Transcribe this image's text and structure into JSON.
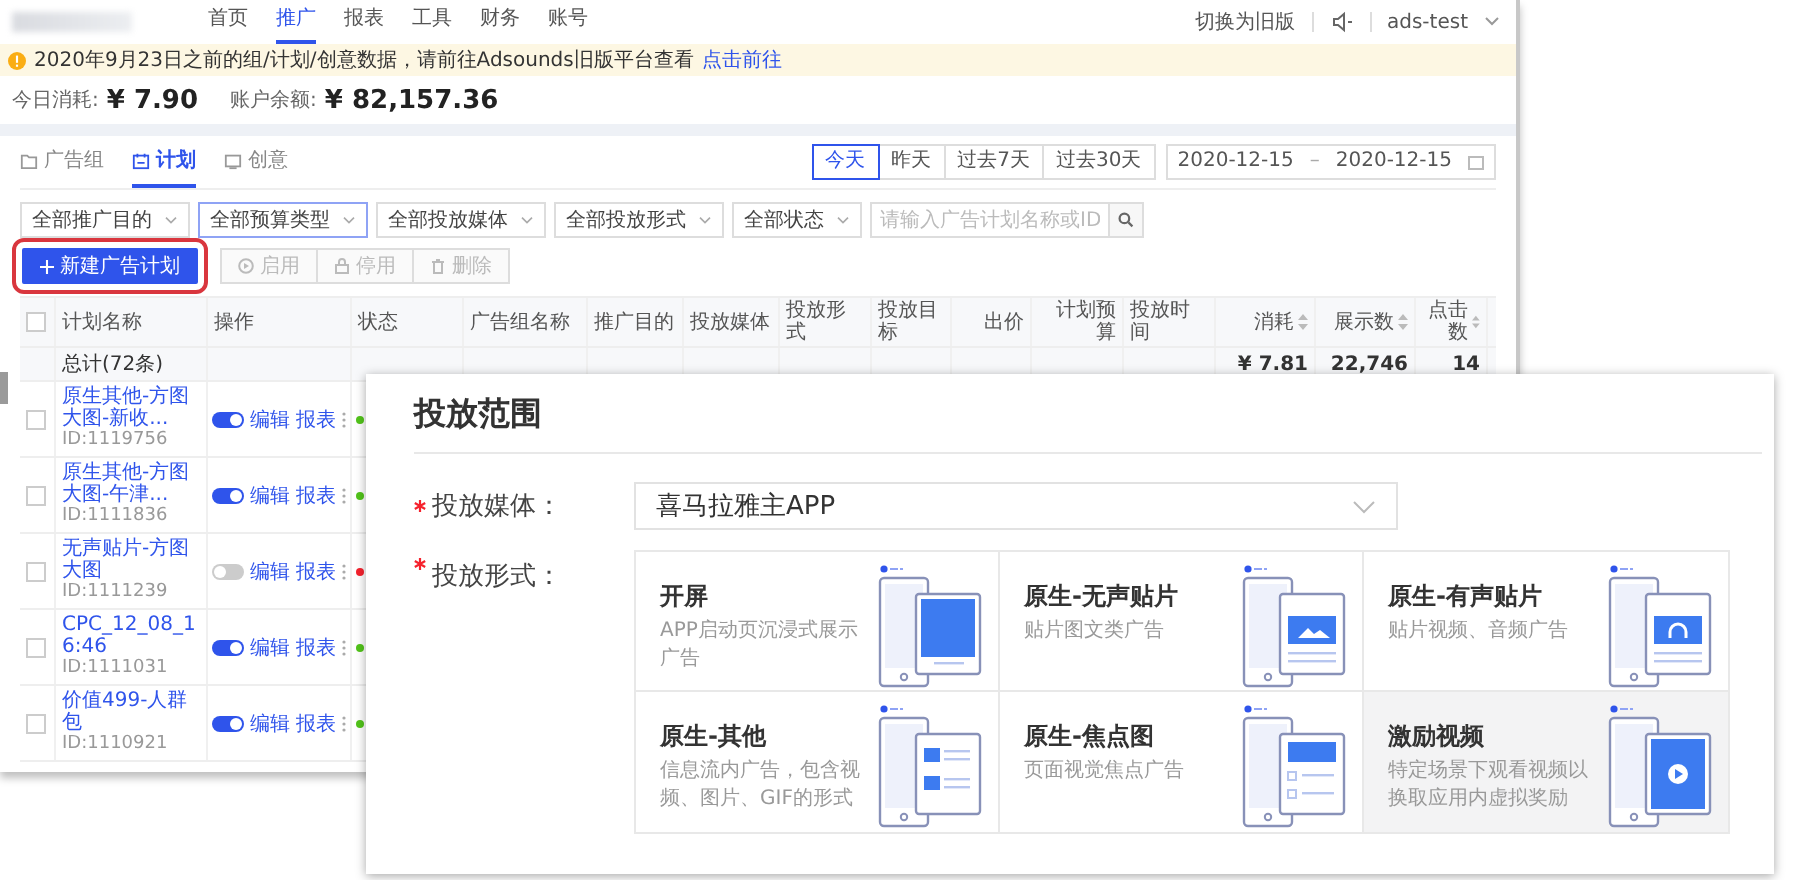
{
  "nav": {
    "items": [
      {
        "label": "首页",
        "selected": false
      },
      {
        "label": "推广",
        "selected": true
      },
      {
        "label": "报表",
        "selected": false
      },
      {
        "label": "工具",
        "selected": false
      },
      {
        "label": "财务",
        "selected": false
      },
      {
        "label": "账号",
        "selected": false
      }
    ],
    "switch_link": "切换为旧版",
    "user": "ads-test"
  },
  "notice": {
    "text": "2020年9月23日之前的组/计划/创意数据，请前往Adsounds旧版平台查看",
    "link": "点击前往"
  },
  "stats": [
    {
      "label": "今日消耗:",
      "value": "¥ 7.90"
    },
    {
      "label": "账户余额:",
      "value": "¥ 82,157.36"
    }
  ],
  "level_tabs": [
    {
      "label": "广告组",
      "kind": "group",
      "selected": false
    },
    {
      "label": "计划",
      "kind": "plan",
      "selected": true
    },
    {
      "label": "创意",
      "kind": "creative",
      "selected": false
    }
  ],
  "date_presets": [
    {
      "label": "今天",
      "selected": true
    },
    {
      "label": "昨天",
      "selected": false
    },
    {
      "label": "过去7天",
      "selected": false
    },
    {
      "label": "过去30天",
      "selected": false
    }
  ],
  "date_range": {
    "start": "2020-12-15",
    "separator": "–",
    "end": "2020-12-15"
  },
  "filters": [
    {
      "label": "全部推广目的",
      "focused": false
    },
    {
      "label": "全部预算类型",
      "focused": true
    },
    {
      "label": "全部投放媒体",
      "focused": false
    },
    {
      "label": "全部投放形式",
      "focused": false
    },
    {
      "label": "全部状态",
      "focused": false
    }
  ],
  "search": {
    "placeholder": "请输入广告计划名称或ID"
  },
  "actions": [
    {
      "label": "新建广告计划",
      "kind": "create",
      "disabled": false,
      "highlighted": true
    },
    {
      "label": "启用",
      "kind": "enable",
      "disabled": true,
      "highlighted": false
    },
    {
      "label": "停用",
      "kind": "pause",
      "disabled": true,
      "highlighted": false
    },
    {
      "label": "删除",
      "kind": "delete",
      "disabled": true,
      "highlighted": false
    }
  ],
  "table": {
    "all_checked": false,
    "columns": [
      {
        "label": "计划名称",
        "sortable": false,
        "kind": "text"
      },
      {
        "label": "操作",
        "sortable": false,
        "kind": "text"
      },
      {
        "label": "状态",
        "sortable": false,
        "kind": "text"
      },
      {
        "label": "广告组名称",
        "sortable": false,
        "kind": "text"
      },
      {
        "label": "推广目的",
        "sortable": false,
        "kind": "text"
      },
      {
        "label": "投放媒体",
        "sortable": false,
        "kind": "text"
      },
      {
        "label": "投放形式",
        "sortable": false,
        "kind": "text"
      },
      {
        "label": "投放目标",
        "sortable": false,
        "kind": "text"
      },
      {
        "label": "出价",
        "sortable": false,
        "kind": "number"
      },
      {
        "label": "计划预算",
        "sortable": false,
        "kind": "number"
      },
      {
        "label": "投放时间",
        "sortable": false,
        "kind": "text"
      },
      {
        "label": "消耗",
        "sortable": true,
        "kind": "number"
      },
      {
        "label": "展示数",
        "sortable": true,
        "kind": "number"
      },
      {
        "label": "点击数",
        "sortable": true,
        "kind": "number"
      }
    ],
    "total": {
      "label": "总计(72条)",
      "spend": "¥ 7.81",
      "impressions": "22,746",
      "clicks": "14"
    },
    "rows": [
      {
        "name": "原生其他-方图大图-新收...",
        "id": "ID:1119756",
        "checked": false,
        "enabled": true,
        "actions": [
          "编辑",
          "报表"
        ],
        "color": "#52c41a"
      },
      {
        "name": "原生其他-方图大图-午津...",
        "id": "ID:1111836",
        "checked": false,
        "enabled": true,
        "actions": [
          "编辑",
          "报表"
        ],
        "color": "#52c41a"
      },
      {
        "name": "无声贴片-方图大图",
        "id": "ID:1111239",
        "checked": false,
        "enabled": false,
        "actions": [
          "编辑",
          "报表"
        ],
        "color": "#f5222d"
      },
      {
        "name": "CPC_12_08_16:46",
        "id": "ID:1111031",
        "checked": false,
        "enabled": true,
        "actions": [
          "编辑",
          "报表"
        ],
        "color": "#52c41a"
      },
      {
        "name": "价值499-人群包",
        "id": "ID:1110921",
        "checked": false,
        "enabled": true,
        "actions": [
          "编辑",
          "报表"
        ],
        "color": "#52c41a"
      }
    ]
  },
  "placement": {
    "title": "投放范围",
    "media": {
      "label": "投放媒体：",
      "required": true,
      "value": "喜马拉雅主APP"
    },
    "format": {
      "label": "投放形式：",
      "required": true,
      "options": [
        {
          "title": "开屏",
          "description": "APP启动页沉浸式展示广告",
          "kind": "splash",
          "selected": false
        },
        {
          "title": "原生-无声贴片",
          "description": "贴片图文类广告",
          "kind": "image",
          "selected": false
        },
        {
          "title": "原生-有声贴片",
          "description": "贴片视频、音频广告",
          "kind": "audio",
          "selected": false
        },
        {
          "title": "原生-其他",
          "description": "信息流内广告，包含视频、图片、GIF的形式",
          "kind": "feed",
          "selected": false
        },
        {
          "title": "原生-焦点图",
          "description": "页面视觉焦点广告",
          "kind": "focus",
          "selected": false
        },
        {
          "title": "激励视频",
          "description": "特定场景下观看视频以换取应用内虚拟奖励",
          "kind": "video",
          "selected": true
        }
      ]
    }
  }
}
